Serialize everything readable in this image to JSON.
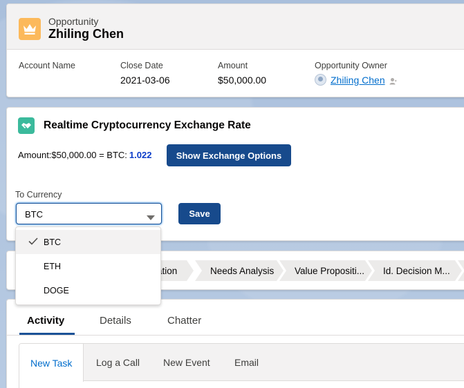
{
  "header": {
    "object_label": "Opportunity",
    "record_name": "Zhiling Chen",
    "fields": [
      {
        "label": "Account Name",
        "value": ""
      },
      {
        "label": "Close Date",
        "value": "2021-03-06"
      },
      {
        "label": "Amount",
        "value": "$50,000.00"
      },
      {
        "label": "Opportunity Owner",
        "value": "Zhiling Chen"
      }
    ]
  },
  "crypto": {
    "title": "Realtime Cryptocurrency Exchange Rate",
    "amount_text": "Amount:$50,000.00 = BTC:",
    "rate": "1.022",
    "show_button": "Show Exchange Options",
    "to_currency_label": "To Currency",
    "selected_currency": "BTC",
    "save_button": "Save",
    "options": [
      "BTC",
      "ETH",
      "DOGE"
    ]
  },
  "path": {
    "stages": [
      "Qualification",
      "Needs Analysis",
      "Value Propositi...",
      "Id. Decision M..."
    ]
  },
  "tabs": {
    "items": [
      "Activity",
      "Details",
      "Chatter"
    ],
    "active": "Activity"
  },
  "activity": {
    "subtabs": [
      "New Task",
      "Log a Call",
      "New Event",
      "Email"
    ]
  },
  "colors": {
    "brand": "#174a8c",
    "link": "#006dcc",
    "rate": "#0b3cc9",
    "opportunity_icon": "#fcb95b",
    "crypto_icon": "#3bba9c"
  }
}
